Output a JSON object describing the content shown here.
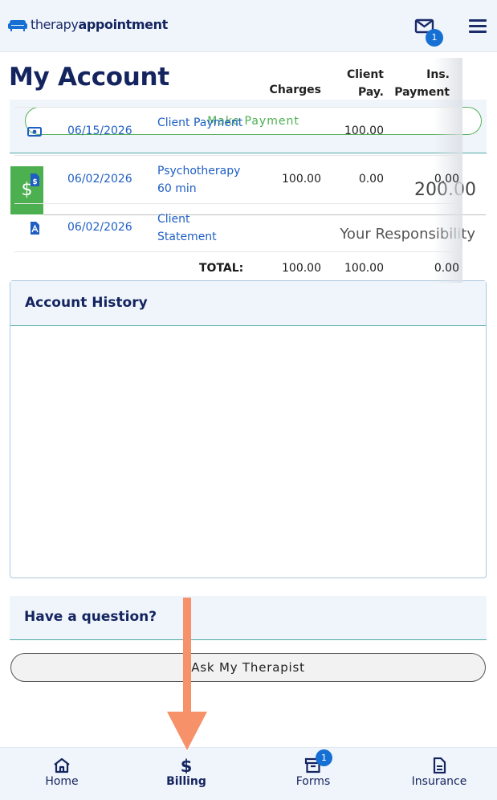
{
  "header": {
    "logo_part1": "therapy",
    "logo_part2": "appointment",
    "mail_badge": "1"
  },
  "page_title": "My Account",
  "payment": {
    "button_label": "Make Payment",
    "currency_symbol": "$",
    "balance": "200.00",
    "balance_caption": "Your Responsibility"
  },
  "account_history": {
    "title": "Account History",
    "columns": [
      "Charges",
      "Client Pay.",
      "Ins. Payment"
    ],
    "rows": [
      {
        "icon": "money-icon",
        "date": "06/15/2026",
        "description": "Client Payment",
        "charges": "",
        "client_pay": "100.00",
        "ins_payment": ""
      },
      {
        "icon": "invoice-icon",
        "date": "06/02/2026",
        "description": "Psychotherapy 60 min",
        "charges": "100.00",
        "client_pay": "0.00",
        "ins_payment": "0.00"
      },
      {
        "icon": "pdf-icon",
        "date": "06/02/2026",
        "description": "Client Statement",
        "charges": "",
        "client_pay": "",
        "ins_payment": ""
      }
    ],
    "total": {
      "label": "TOTAL:",
      "charges": "100.00",
      "client_pay": "100.00",
      "ins_payment": "0.00"
    }
  },
  "question": {
    "title": "Have a question?",
    "button_label": "Ask My Therapist"
  },
  "bottom_nav": {
    "items": [
      {
        "label": "Home",
        "icon": "home-icon"
      },
      {
        "label": "Billing",
        "icon": "dollar-icon",
        "active": true
      },
      {
        "label": "Forms",
        "icon": "archive-icon",
        "badge": "1"
      },
      {
        "label": "Insurance",
        "icon": "document-icon"
      }
    ]
  },
  "colors": {
    "primary": "#14245f",
    "accent_green": "#4caf50",
    "link_blue": "#1f5fc4",
    "badge_blue": "#1670d4",
    "annotation_arrow": "#f6916a"
  }
}
